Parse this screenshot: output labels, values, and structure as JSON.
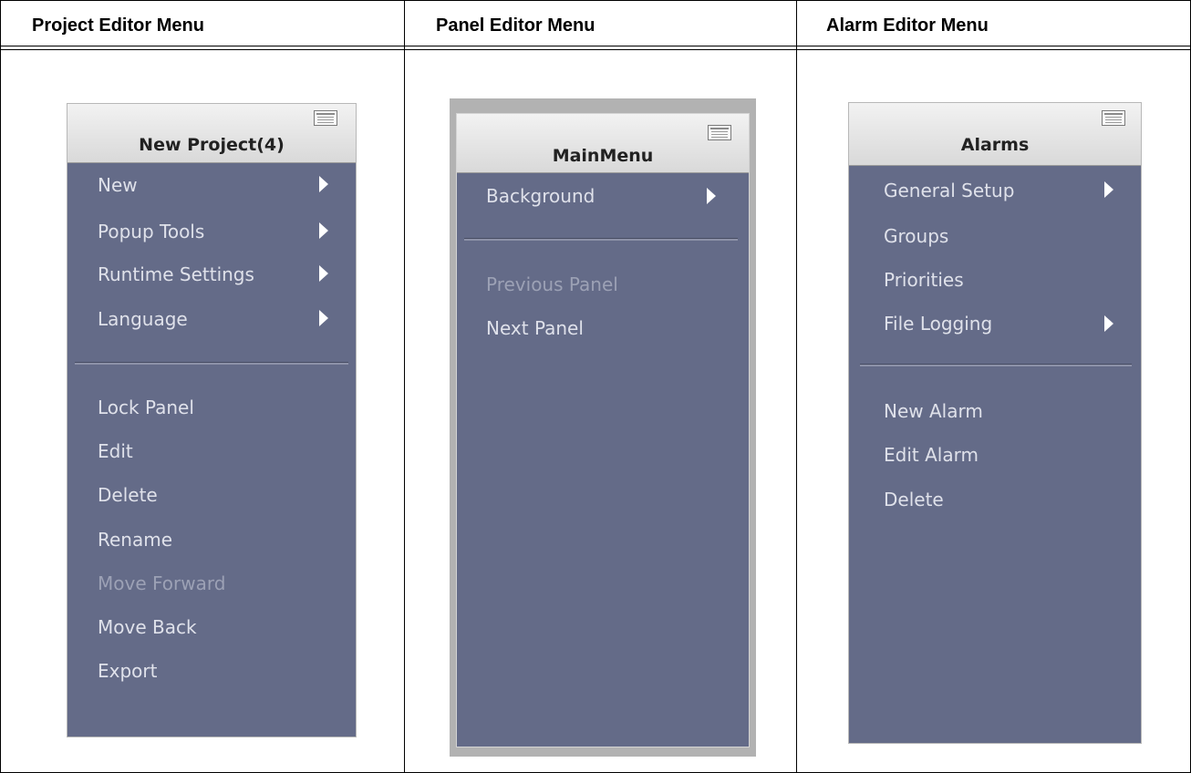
{
  "columns": {
    "project": "Project Editor Menu",
    "panel": "Panel Editor Menu",
    "alarm": "Alarm Editor Menu"
  },
  "project_menu": {
    "title": "New Project(4)",
    "items": [
      {
        "label": "New",
        "submenu": true
      },
      {
        "label": "Popup Tools",
        "submenu": true
      },
      {
        "label": "Runtime Settings",
        "submenu": true
      },
      {
        "label": "Language",
        "submenu": true
      },
      {
        "label": "Lock Panel"
      },
      {
        "label": "Edit"
      },
      {
        "label": "Delete"
      },
      {
        "label": "Rename"
      },
      {
        "label": "Move Forward",
        "disabled": true
      },
      {
        "label": "Move Back"
      },
      {
        "label": "Export"
      }
    ]
  },
  "panel_menu": {
    "title": "MainMenu",
    "items": [
      {
        "label": "Background",
        "submenu": true
      },
      {
        "label": "Previous Panel",
        "disabled": true
      },
      {
        "label": "Next Panel"
      }
    ]
  },
  "alarm_menu": {
    "title": "Alarms",
    "items": [
      {
        "label": "General Setup",
        "submenu": true
      },
      {
        "label": "Groups"
      },
      {
        "label": "Priorities"
      },
      {
        "label": "File Logging",
        "submenu": true
      },
      {
        "label": "New Alarm"
      },
      {
        "label": "Edit Alarm"
      },
      {
        "label": "Delete"
      }
    ]
  },
  "colors": {
    "menu_background": "#646b88",
    "item_text": "#dfe1ea",
    "disabled_text": "#9ca1b5"
  }
}
